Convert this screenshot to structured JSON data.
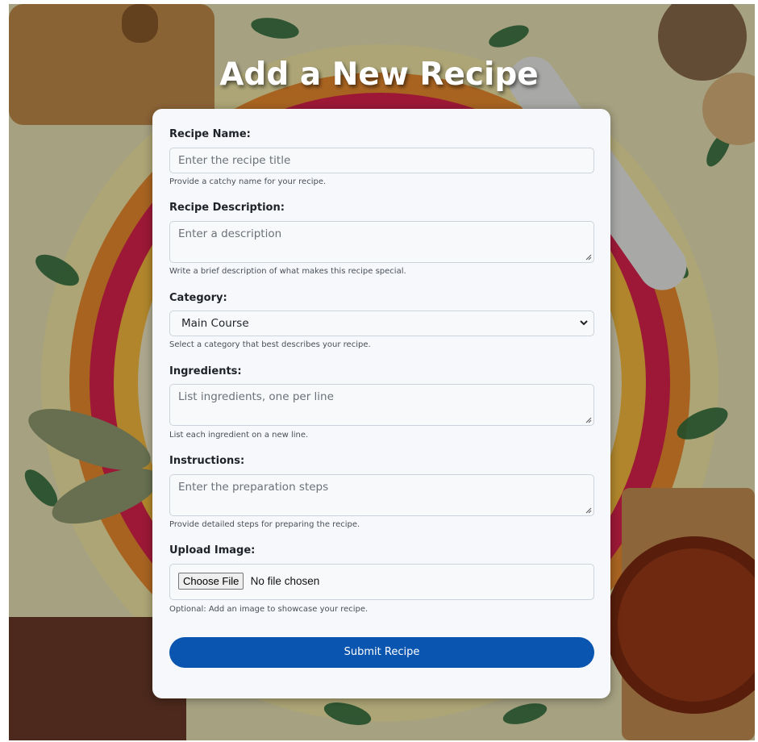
{
  "page": {
    "title": "Add a New Recipe"
  },
  "form": {
    "name": {
      "label": "Recipe Name:",
      "placeholder": "Enter the recipe title",
      "help": "Provide a catchy name for your recipe."
    },
    "description": {
      "label": "Recipe Description:",
      "placeholder": "Enter a description",
      "help": "Write a brief description of what makes this recipe special."
    },
    "category": {
      "label": "Category:",
      "selected": "Main Course",
      "help": "Select a category that best describes your recipe."
    },
    "ingredients": {
      "label": "Ingredients:",
      "placeholder": "List ingredients, one per line",
      "help": "List each ingredient on a new line."
    },
    "instructions": {
      "label": "Instructions:",
      "placeholder": "Enter the preparation steps",
      "help": "Provide detailed steps for preparing the recipe."
    },
    "image": {
      "label": "Upload Image:",
      "button": "Choose File",
      "status": "No file chosen",
      "help": "Optional: Add an image to showcase your recipe."
    },
    "submit_label": "Submit Recipe"
  },
  "colors": {
    "accent": "#0a55b0",
    "card": "#f6f8fb",
    "title": "#ffffff"
  },
  "icons": {
    "select": "chevron-down-icon",
    "textarea": "resize-handle-icon"
  }
}
